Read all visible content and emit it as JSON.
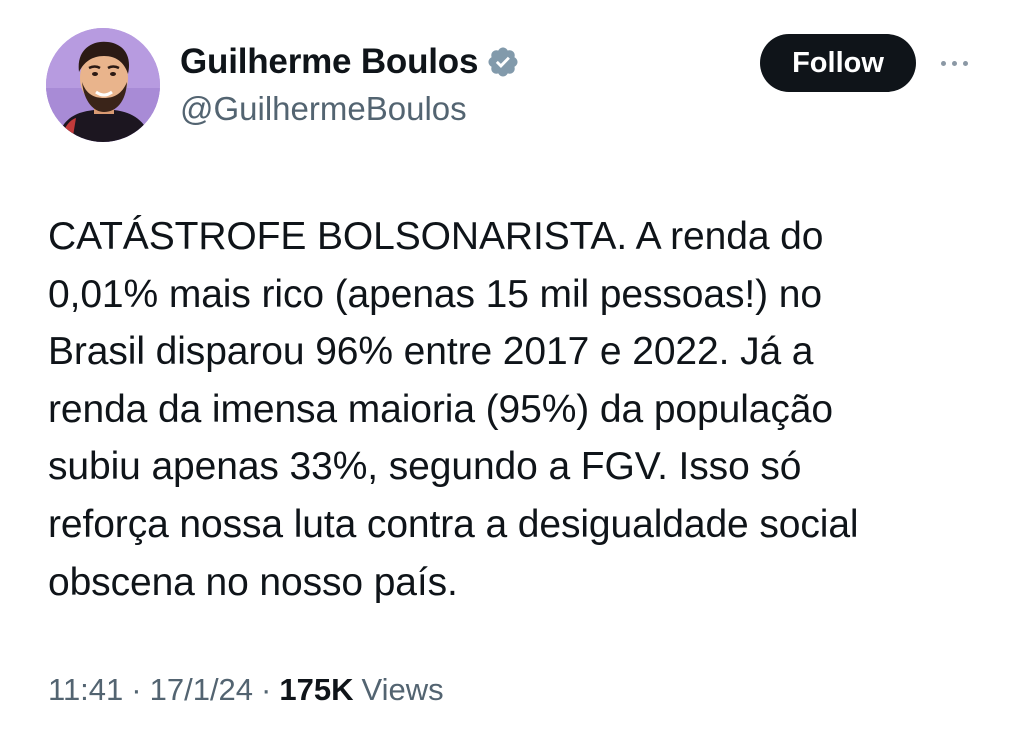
{
  "author": {
    "display_name": "Guilherme Boulos",
    "handle": "@GuilhermeBoulos",
    "verified": true,
    "avatar_icon": "profile-photo-avatar"
  },
  "actions": {
    "follow_label": "Follow",
    "more_icon": "more-options-icon"
  },
  "tweet": {
    "text": "CATÁSTROFE BOLSONARISTA. A renda do\n0,01% mais rico (apenas 15 mil pessoas!) no\nBrasil disparou 96% entre 2017 e 2022. Já a\nrenda da imensa maioria (95%) da população\nsubiu apenas 33%, segundo a FGV. Isso só\nreforça nossa luta contra a desigualdade social\nobscena no nosso país."
  },
  "meta": {
    "time": "11:41",
    "separator": "·",
    "date": "17/1/24",
    "views_count": "175K",
    "views_label": "Views"
  },
  "colors": {
    "text_primary": "#0f1419",
    "text_secondary": "#536471",
    "verified_badge": "#829aab",
    "follow_bg": "#0f1419",
    "avatar_bg": "#b79be0"
  }
}
